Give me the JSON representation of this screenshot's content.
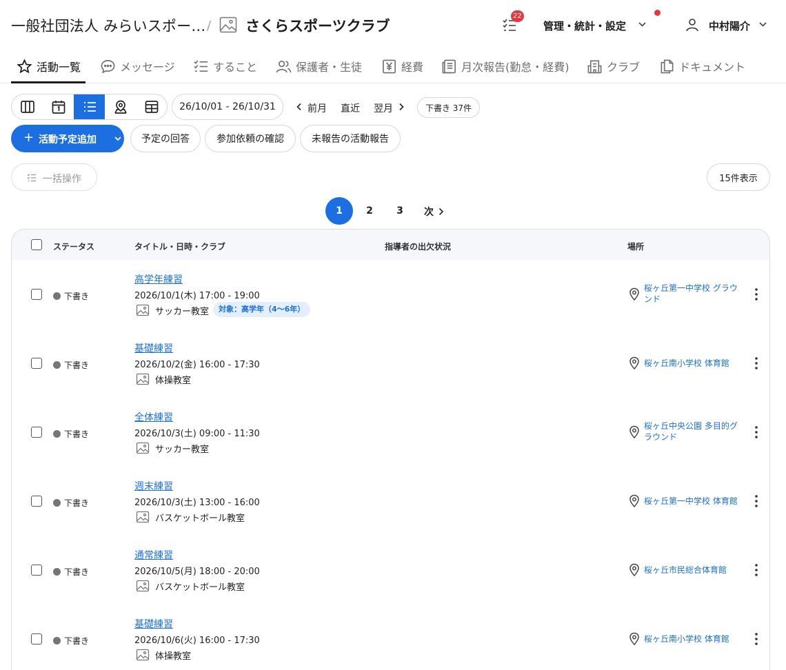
{
  "header": {
    "org": "一般社団法人 みらいスポー…",
    "separator": "/",
    "club": "さくらスポーツクラブ",
    "todo_badge": "22",
    "admin_menu": "管理・統計・設定",
    "user": "中村陽介"
  },
  "tabs": [
    {
      "label": "活動一覧",
      "icon": "star-icon"
    },
    {
      "label": "メッセージ",
      "icon": "chat-icon"
    },
    {
      "label": "すること",
      "icon": "checklist-icon"
    },
    {
      "label": "保護者・生徒",
      "icon": "people-icon"
    },
    {
      "label": "経費",
      "icon": "yen-icon"
    },
    {
      "label": "月次報告(勤怠・経費)",
      "icon": "report-icon"
    },
    {
      "label": "クラブ",
      "icon": "building-icon"
    },
    {
      "label": "ドキュメント",
      "icon": "document-icon"
    }
  ],
  "toolbar": {
    "date_range": "26/10/01 - 26/10/31",
    "prev": "前月",
    "current": "直近",
    "next": "翌月",
    "drafts": "下書き 37件",
    "add_label": "活動予定追加",
    "answer_label": "予定の回答",
    "request_label": "参加依頼の確認",
    "unreported_label": "未報告の活動報告",
    "bulk_label": "一括操作",
    "per_page": "15件表示"
  },
  "pagination": {
    "pages": [
      "1",
      "2",
      "3"
    ],
    "next": "次"
  },
  "table": {
    "headers": {
      "status": "ステータス",
      "title": "タイトル・日時・クラブ",
      "attendance": "指導者の出欠状況",
      "place": "場所"
    },
    "rows": [
      {
        "status": "下書き",
        "title": "高学年練習",
        "datetime": "2026/10/1(木) 17:00 - 19:00",
        "club": "サッカー教室",
        "target": "対象：高学年（4〜6年）",
        "place_l1": "桜ヶ丘第一中学校 グラウ",
        "place_l2": "ンド"
      },
      {
        "status": "下書き",
        "title": "基礎練習",
        "datetime": "2026/10/2(金) 16:00 - 17:30",
        "club": "体操教室",
        "target": "",
        "place_l1": "桜ヶ丘南小学校 体育館",
        "place_l2": ""
      },
      {
        "status": "下書き",
        "title": "全体練習",
        "datetime": "2026/10/3(土) 09:00 - 11:30",
        "club": "サッカー教室",
        "target": "",
        "place_l1": "桜ヶ丘中央公園 多目的グ",
        "place_l2": "ラウンド"
      },
      {
        "status": "下書き",
        "title": "週末練習",
        "datetime": "2026/10/3(土) 13:00 - 16:00",
        "club": "バスケットボール教室",
        "target": "",
        "place_l1": "桜ヶ丘第一中学校 体育館",
        "place_l2": ""
      },
      {
        "status": "下書き",
        "title": "通常練習",
        "datetime": "2026/10/5(月) 18:00 - 20:00",
        "club": "バスケットボール教室",
        "target": "",
        "place_l1": "桜ヶ丘市民総合体育館",
        "place_l2": ""
      },
      {
        "status": "下書き",
        "title": "基礎練習",
        "datetime": "2026/10/6(火) 16:00 - 17:30",
        "club": "体操教室",
        "target": "",
        "place_l1": "桜ヶ丘南小学校 体育館",
        "place_l2": ""
      }
    ]
  },
  "colors": {
    "accent": "#1c6fe0",
    "badge": "#e5373f",
    "draft_dot": "#757575"
  }
}
